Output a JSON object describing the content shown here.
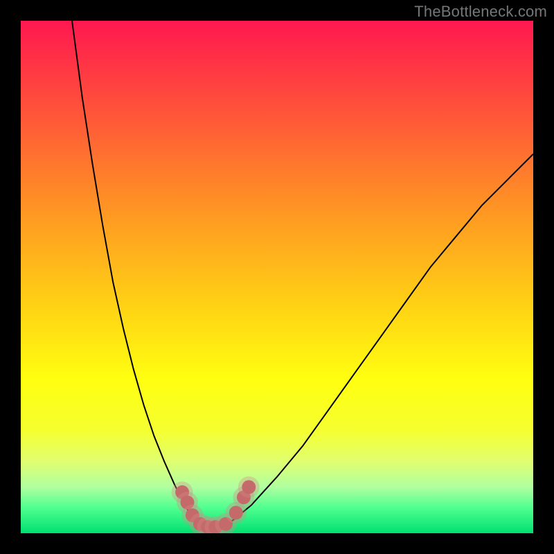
{
  "attribution": "TheBottleneck.com",
  "colors": {
    "gradient_top": "#ff1850",
    "gradient_mid": "#ffff10",
    "gradient_bottom": "#00e070",
    "curve": "#000000",
    "marker_fill": "#c46a6a",
    "frame": "#000000"
  },
  "chart_data": {
    "type": "line",
    "title": "",
    "xlabel": "",
    "ylabel": "",
    "xlim": [
      0,
      100
    ],
    "ylim": [
      0,
      100
    ],
    "grid": false,
    "legend": false,
    "series": [
      {
        "name": "left-limb",
        "x": [
          10,
          12,
          14,
          16,
          18,
          20,
          22,
          24,
          26,
          28,
          30,
          32,
          33.5,
          35
        ],
        "y": [
          100,
          85,
          72,
          60,
          49,
          40,
          32,
          25,
          19,
          14,
          9.5,
          5.5,
          3,
          1.5
        ]
      },
      {
        "name": "right-limb",
        "x": [
          40,
          42,
          45,
          50,
          55,
          60,
          65,
          70,
          75,
          80,
          85,
          90,
          95,
          100
        ],
        "y": [
          1.5,
          3,
          5.5,
          11,
          17,
          24,
          31,
          38,
          45,
          52,
          58,
          64,
          69,
          74
        ]
      },
      {
        "name": "floor",
        "x": [
          35,
          36.5,
          38,
          40
        ],
        "y": [
          1.5,
          1,
          1,
          1.5
        ]
      }
    ],
    "bottleneck_markers": {
      "name": "bottleneck-range",
      "points": [
        {
          "x": 31.5,
          "y": 8
        },
        {
          "x": 32.5,
          "y": 6
        },
        {
          "x": 33.5,
          "y": 3.5
        },
        {
          "x": 35,
          "y": 1.8
        },
        {
          "x": 36.5,
          "y": 1.2
        },
        {
          "x": 38,
          "y": 1.2
        },
        {
          "x": 40,
          "y": 1.8
        },
        {
          "x": 42,
          "y": 4
        },
        {
          "x": 43.5,
          "y": 7
        },
        {
          "x": 44.5,
          "y": 9
        }
      ],
      "marker_radius_pct": 1.35
    }
  }
}
